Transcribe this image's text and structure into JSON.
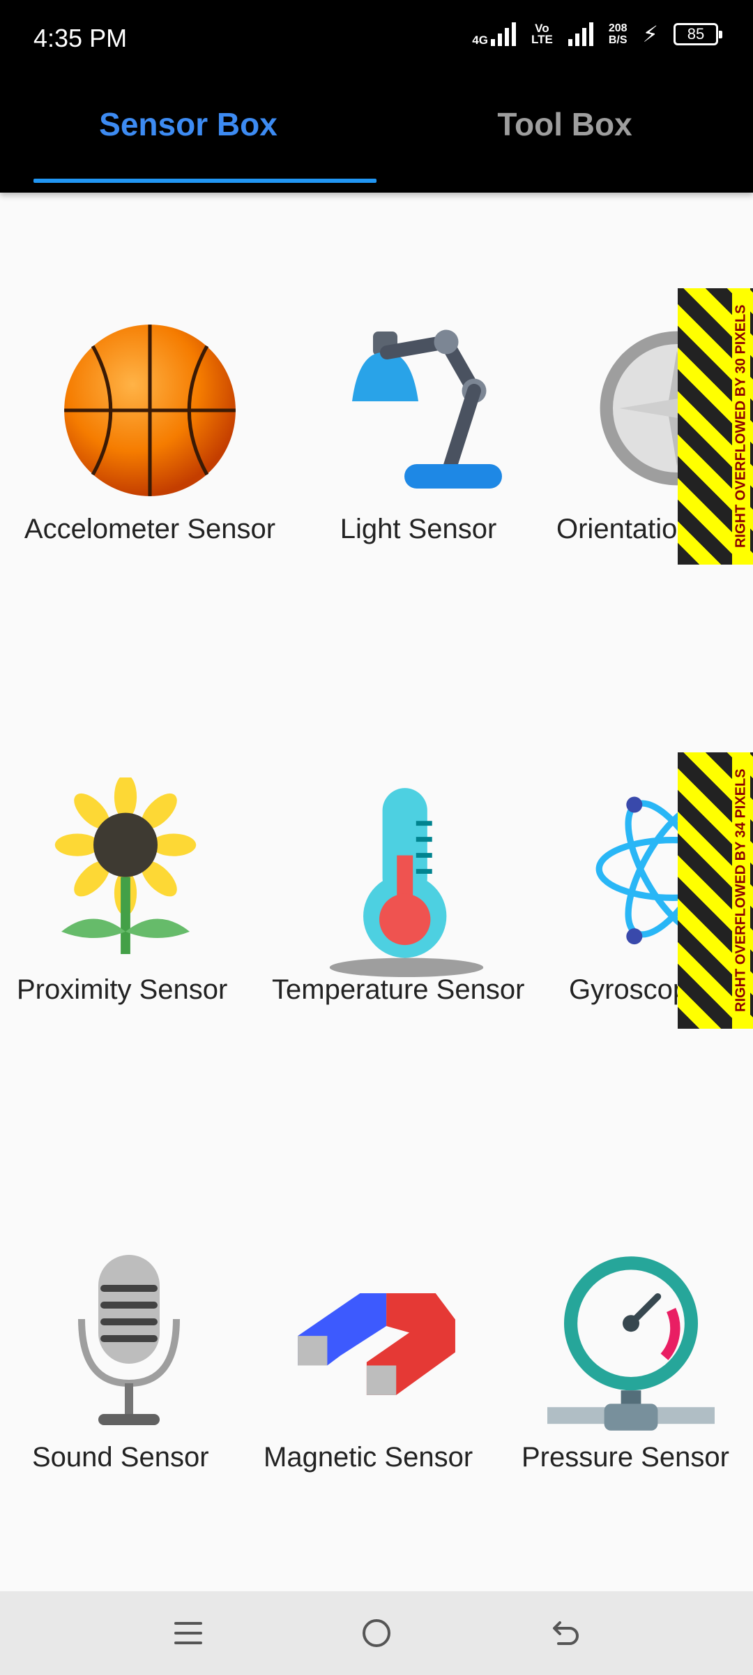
{
  "status_bar": {
    "time": "4:35 PM",
    "network_4g": "4G",
    "volte_top": "Vo",
    "volte_bottom": "LTE",
    "speed_value": "208",
    "speed_unit": "B/S",
    "battery": "85"
  },
  "tabs": [
    {
      "label": "Sensor Box",
      "selected": true
    },
    {
      "label": "Tool Box",
      "selected": false
    }
  ],
  "colors": {
    "accent": "#2196f3",
    "tab_selected": "#3d8bf2",
    "tab_unselected": "#9e9e9e",
    "overflow_yellow": "#ffff00",
    "overflow_text": "#8b0000"
  },
  "sensors": [
    {
      "label": "Accelometer Sensor",
      "icon": "basketball-icon"
    },
    {
      "label": "Light Sensor",
      "icon": "desk-lamp-icon"
    },
    {
      "label": "Orientation Se",
      "icon": "compass-icon"
    },
    {
      "label": "Proximity Sensor",
      "icon": "sunflower-icon"
    },
    {
      "label": "Temperature Sensor",
      "icon": "thermometer-icon"
    },
    {
      "label": "Gyroscope Se",
      "icon": "atom-icon"
    },
    {
      "label": "Sound Sensor",
      "icon": "microphone-icon"
    },
    {
      "label": "Magnetic Sensor",
      "icon": "magnet-icon"
    },
    {
      "label": "Pressure Sensor",
      "icon": "pressure-gauge-icon"
    }
  ],
  "overflow_warnings": [
    "RIGHT OVERFLOWED BY 30 PIXELS",
    "RIGHT OVERFLOWED BY 34 PIXELS"
  ],
  "nav_bar": {
    "buttons": [
      "menu-icon",
      "home-icon",
      "back-icon"
    ]
  }
}
